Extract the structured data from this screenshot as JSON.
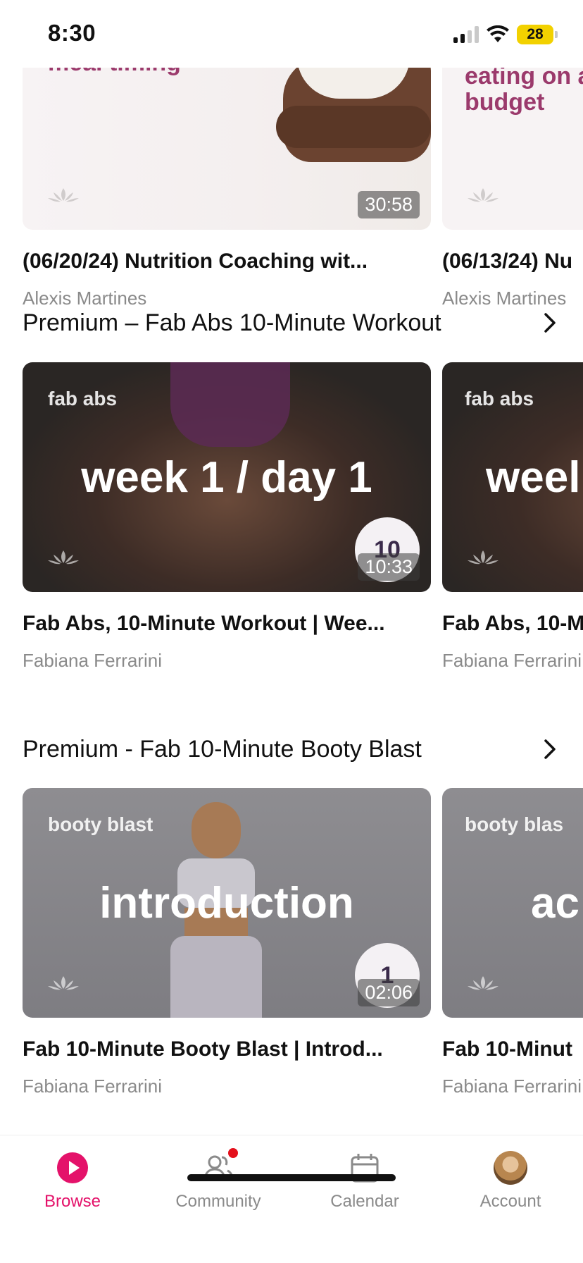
{
  "status_bar": {
    "time": "8:30",
    "battery": "28"
  },
  "rows": {
    "nutrition": {
      "cards": [
        {
          "overlay_text": "meal timing",
          "duration": "30:58",
          "title": "(06/20/24) Nutrition Coaching wit...",
          "author": "Alexis Martines"
        },
        {
          "overlay_text": "eating on a budget",
          "title": "(06/13/24) Nu",
          "author": "Alexis Martines"
        }
      ]
    },
    "fab_abs": {
      "header": "Premium – Fab Abs 10-Minute Workout",
      "cards": [
        {
          "small_label": "fab abs",
          "big_label": "week 1 / day 1",
          "badge": "10",
          "duration": "10:33",
          "title": "Fab Abs, 10-Minute Workout | Wee...",
          "author": "Fabiana Ferrarini"
        },
        {
          "small_label": "fab abs",
          "big_label": "weel",
          "title": "Fab Abs, 10-M",
          "author": "Fabiana Ferrarini"
        }
      ]
    },
    "booty_blast": {
      "header": "Premium - Fab 10-Minute Booty Blast",
      "cards": [
        {
          "small_label": "booty blast",
          "big_label": "introduction",
          "badge": "1",
          "duration": "02:06",
          "title": "Fab 10-Minute Booty Blast | Introd...",
          "author": "Fabiana Ferrarini"
        },
        {
          "small_label": "booty blas",
          "big_label": "ac",
          "title": "Fab 10-Minut",
          "author": "Fabiana Ferrarini"
        }
      ]
    }
  },
  "tabbar": {
    "tabs": [
      {
        "label": "Browse",
        "icon": "play-circle-icon",
        "active": true
      },
      {
        "label": "Community",
        "icon": "people-icon",
        "notification": true
      },
      {
        "label": "Calendar",
        "icon": "calendar-icon"
      },
      {
        "label": "Account",
        "icon": "avatar"
      }
    ]
  },
  "colors": {
    "accent": "#e4126a",
    "nutrition_text": "#9b3a6c"
  }
}
